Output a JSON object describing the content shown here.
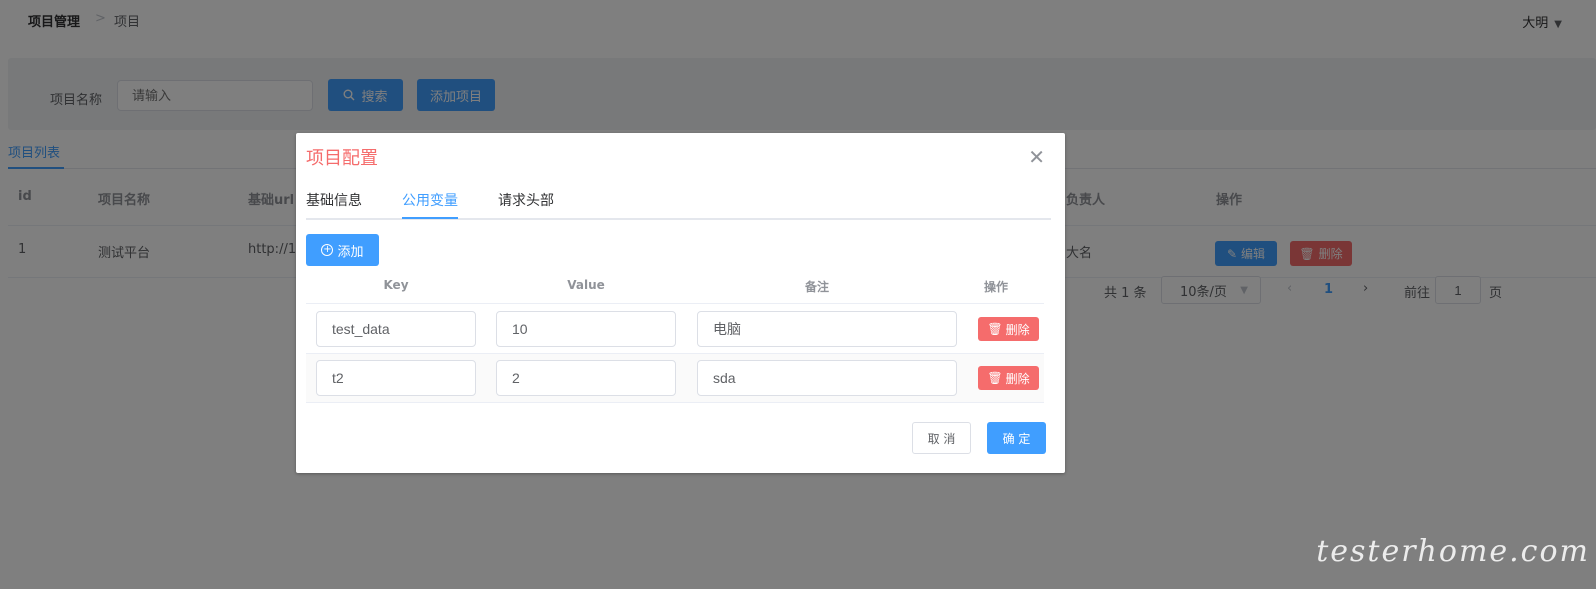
{
  "breadcrumb": {
    "main": "项目管理",
    "separator": ">",
    "sub": "项目"
  },
  "user": {
    "name": "大明"
  },
  "search": {
    "label": "项目名称",
    "placeholder": "请输入",
    "search_button": "搜索",
    "add_button": "添加项目"
  },
  "list": {
    "tab": "项目列表",
    "columns": [
      "id",
      "项目名称",
      "基础url",
      "负责人",
      "操作"
    ],
    "rows": [
      {
        "id": "1",
        "name": "测试平台",
        "url": "http://1",
        "owner": "大名",
        "edit": "编辑",
        "delete": "删除"
      }
    ]
  },
  "pagination": {
    "total": "共 1 条",
    "page_size": "10条/页",
    "current": "1",
    "goto_label": "前往",
    "goto_value": "1",
    "page_label": "页"
  },
  "dialog": {
    "title": "项目配置",
    "tabs": [
      "基础信息",
      "公用变量",
      "请求头部"
    ],
    "active_tab": "公用变量",
    "add_button": "添加",
    "columns": [
      "Key",
      "Value",
      "备注",
      "操作"
    ],
    "rows": [
      {
        "key": "test_data",
        "value": "10",
        "note": "电脑",
        "delete": "删除"
      },
      {
        "key": "t2",
        "value": "2",
        "note": "sda",
        "delete": "删除"
      }
    ],
    "cancel": "取 消",
    "confirm": "确 定"
  },
  "watermark": "testerhome.com",
  "colors": {
    "primary": "#409eff",
    "danger": "#f56c6c",
    "title": "#f56c6c"
  }
}
